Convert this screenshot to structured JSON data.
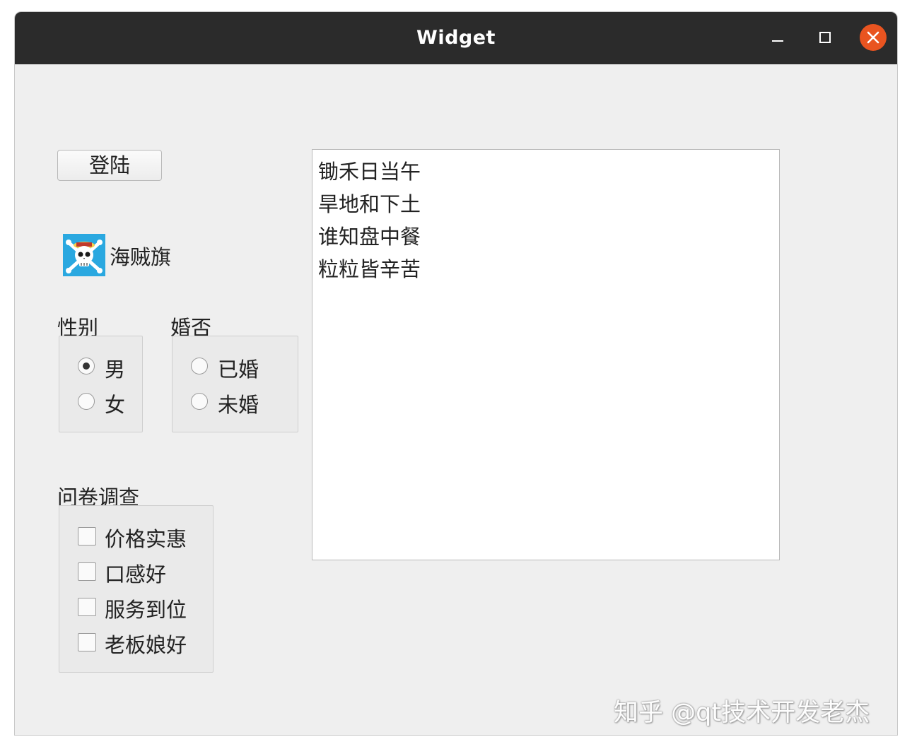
{
  "window": {
    "title": "Widget"
  },
  "login_button": "登陆",
  "pirate": {
    "label": "海贼旗",
    "icon": "pirate-flag-icon",
    "icon_bg": "#2aa8e0"
  },
  "gender": {
    "title": "性别",
    "options": [
      {
        "label": "男",
        "checked": true
      },
      {
        "label": "女",
        "checked": false
      }
    ]
  },
  "marriage": {
    "title": "婚否",
    "options": [
      {
        "label": "已婚",
        "checked": false
      },
      {
        "label": "未婚",
        "checked": false
      }
    ]
  },
  "survey": {
    "title": "问卷调查",
    "options": [
      {
        "label": "价格实惠",
        "checked": false
      },
      {
        "label": "口感好",
        "checked": false
      },
      {
        "label": "服务到位",
        "checked": false
      },
      {
        "label": "老板娘好",
        "checked": false
      }
    ]
  },
  "poem": [
    "锄禾日当午",
    "旱地和下土",
    "谁知盘中餐",
    "粒粒皆辛苦"
  ],
  "watermark": "知乎 @qt技术开发老杰",
  "colors": {
    "titlebar": "#2b2b2b",
    "close_button": "#e95420",
    "window_bg": "#efefef"
  }
}
